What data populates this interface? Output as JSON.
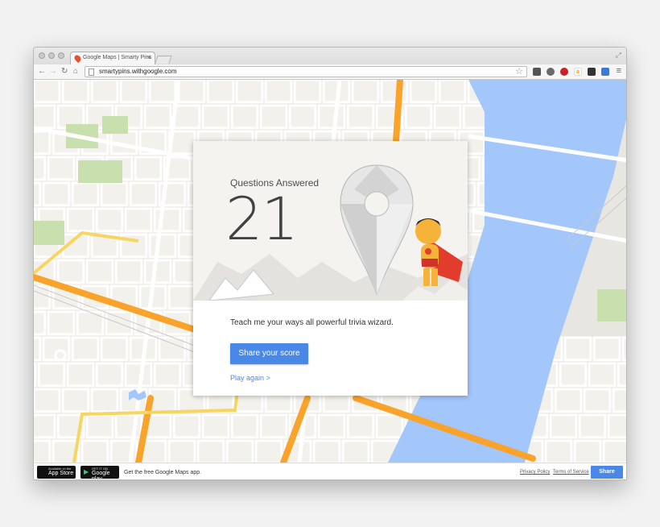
{
  "browser": {
    "tab_title": "Google Maps | Smarty Pins",
    "tab_close": "×",
    "expand_glyph": "⤢",
    "url": "smartypins.withgoogle.com",
    "nav": {
      "back": "←",
      "forward": "→",
      "reload": "↻",
      "home": "⌂"
    },
    "star": "☆",
    "menu": "≡",
    "extensions": [
      {
        "icon": "pocket-icon",
        "color": "#555555"
      },
      {
        "icon": "evernote-icon",
        "color": "#6a6a6a"
      },
      {
        "icon": "pinterest-icon",
        "color": "#cb2027"
      },
      {
        "icon": "amazon-icon",
        "color": "#ff9900"
      },
      {
        "icon": "extension-icon",
        "color": "#333333"
      },
      {
        "icon": "cast-icon",
        "color": "#3b78d8"
      }
    ]
  },
  "card": {
    "label": "Questions Answered",
    "count": "21",
    "tagline": "Teach me your ways all powerful trivia wizard.",
    "share_button": "Share your score",
    "play_again": "Play again >"
  },
  "footer": {
    "app_store": {
      "small": "Available on the",
      "big": "App Store",
      "icon": ""
    },
    "google_play": {
      "small": "GET IT ON",
      "big": "Google play",
      "icon": "▶"
    },
    "promo": "Get the free Google Maps app.",
    "privacy": "Privacy Policy",
    "terms": "Terms of Service",
    "share": "Share"
  },
  "colors": {
    "accent": "#4a88e8",
    "water": "#a3c6fb",
    "highway": "#f9a32b",
    "park": "#c8dfae",
    "block": "#f3f1ec"
  }
}
